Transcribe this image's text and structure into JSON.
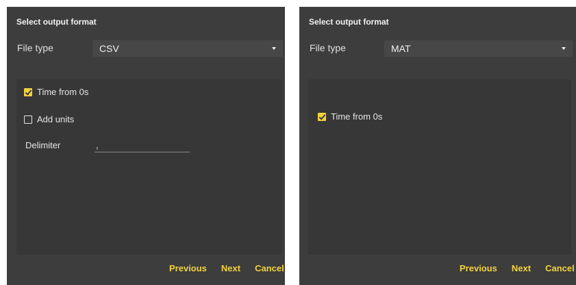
{
  "dialogs": [
    {
      "title": "Select output format",
      "file_type_label": "File type",
      "file_type_value": "CSV",
      "time_from_zero": {
        "label": "Time from 0s",
        "checked": true
      },
      "add_units": {
        "label": "Add units",
        "checked": false
      },
      "delimiter": {
        "label": "Delimiter",
        "value": ","
      },
      "buttons": {
        "previous": "Previous",
        "next": "Next",
        "cancel": "Cancel"
      }
    },
    {
      "title": "Select output format",
      "file_type_label": "File type",
      "file_type_value": "MAT",
      "time_from_zero": {
        "label": "Time from 0s",
        "checked": true
      },
      "buttons": {
        "previous": "Previous",
        "next": "Next",
        "cancel": "Cancel"
      }
    }
  ],
  "colors": {
    "dialog_bg": "#3d3d3d",
    "panel_bg": "#373737",
    "accent": "#f2d23c"
  },
  "icons": [
    "dropdown-caret-icon",
    "checkbox-checked-icon",
    "checkbox-unchecked-icon"
  ]
}
